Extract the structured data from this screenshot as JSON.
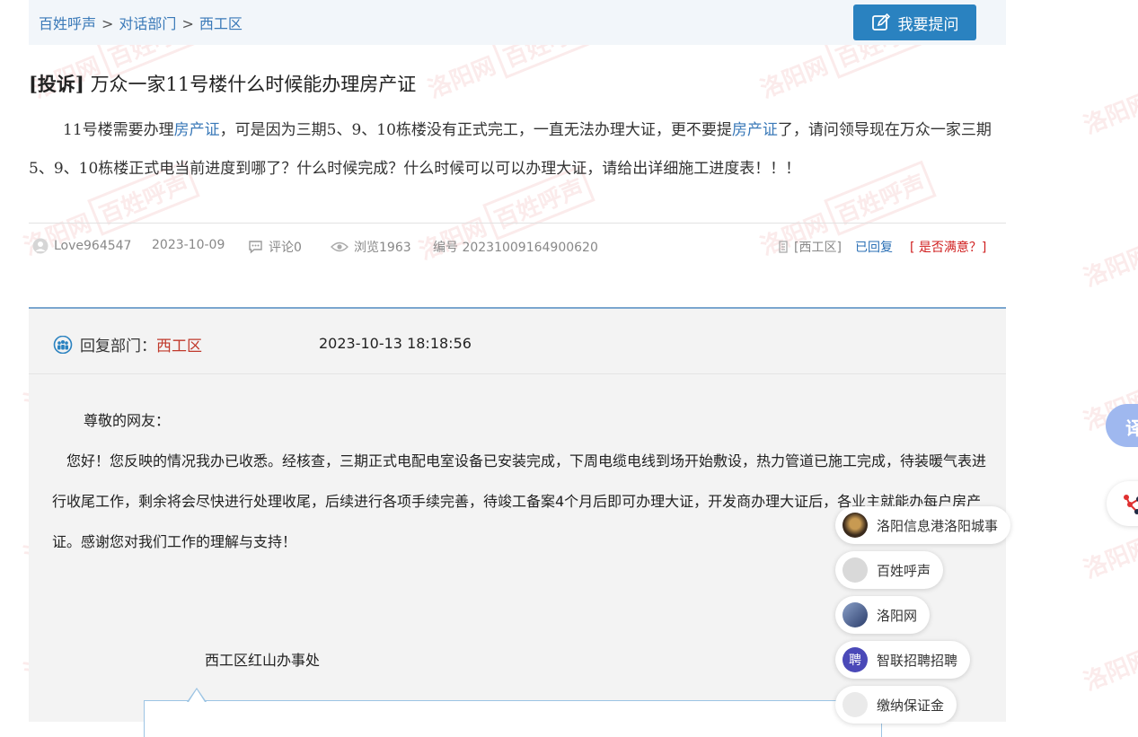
{
  "breadcrumb": {
    "items": [
      "百姓呼声",
      "对话部门",
      "西工区"
    ],
    "separator": ">"
  },
  "ask_button": {
    "label": "我要提问",
    "icon": "edit-icon"
  },
  "post": {
    "tag": "[投诉]",
    "title": "万众一家11号楼什么时候能办理房产证",
    "body": {
      "part1": "11号楼需要办理",
      "kw1": "房产证",
      "part2": "，可是因为三期5、9、10栋楼没有正式完工，一直无法办理大证，更不要提",
      "kw2": "房产证",
      "part3": "了，请问领导现在万众一家三期5、9、10栋楼正式电当前进度到哪了？什么时候完成？什么时候可以可以办理大证，请给出详细施工进度表！！！"
    }
  },
  "meta": {
    "user": "Love964547",
    "date": "2023-10-09",
    "comments": "评论0",
    "views": "浏览1963",
    "number": "编号 20231009164900620",
    "district": "[西工区]",
    "status": "已回复",
    "satisfaction": "[ 是否满意？]"
  },
  "reply": {
    "dept_label": "回复部门：",
    "dept": "西工区",
    "time": "2023-10-13 18:18:56",
    "greeting": "尊敬的网友：",
    "content": "您好！您反映的情况我办已收悉。经核查，三期正式电配电室设备已安装完成，下周电缆电线到场开始敷设，热力管道已施工完成，待装暖气表进行收尾工作，剩余将会尽快进行处理收尾，后续进行各项手续完善，待竣工备案4个月后即可办理大证，开发商办理大证后，各业主就能办每户房产证。感谢您对我们工作的理解与支持！",
    "signature": "西工区红山办事处"
  },
  "floating_chips": [
    {
      "label": "洛阳信息港洛阳城事"
    },
    {
      "label": "百姓呼声"
    },
    {
      "label": "洛阳网"
    },
    {
      "label": "智联招聘招聘"
    },
    {
      "label": "缴纳保证金"
    }
  ],
  "edge": {
    "translate_glyph": "译"
  },
  "watermark": {
    "site": "洛阳网",
    "brand": "百姓呼声"
  },
  "colors": {
    "link": "#3a79b8",
    "accent": "#2a82c0",
    "red": "#c0392b"
  }
}
